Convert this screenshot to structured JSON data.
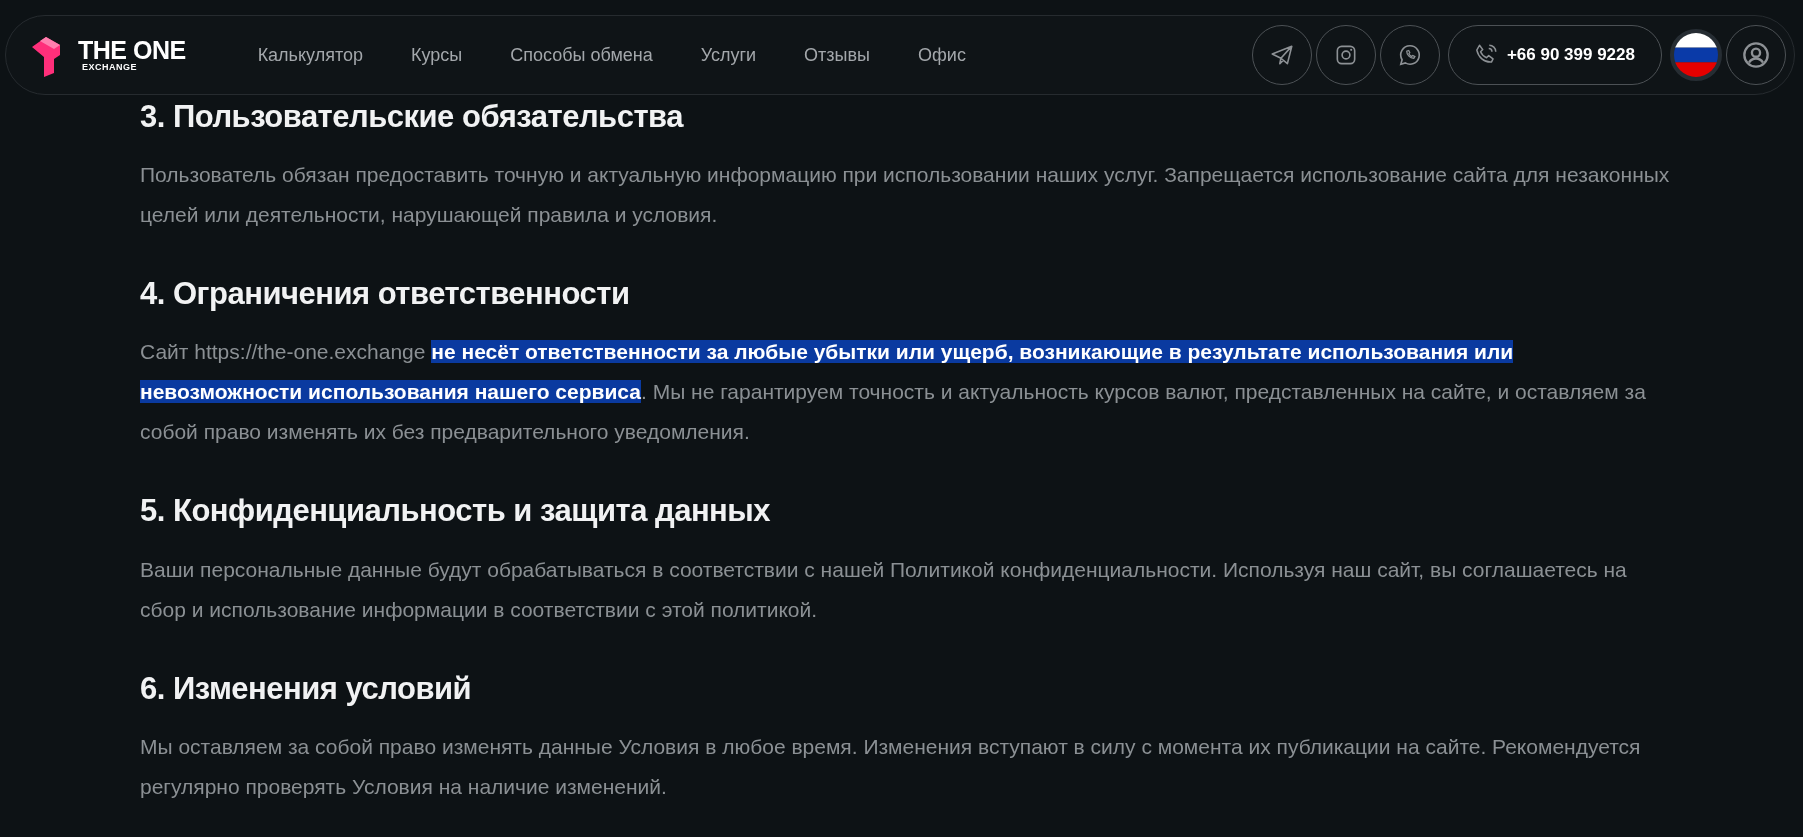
{
  "header": {
    "logo": {
      "title": "THE ONE",
      "subtitle": "EXCHANGE"
    },
    "nav": [
      "Калькулятор",
      "Курсы",
      "Способы обмена",
      "Услуги",
      "Отзывы",
      "Офис"
    ],
    "socials": [
      {
        "kind": "telegram"
      },
      {
        "kind": "instagram"
      },
      {
        "kind": "whatsapp"
      }
    ],
    "phone": "+66 90 399 9228",
    "language": {
      "kind": "ru"
    },
    "account": {
      "kind": "user"
    }
  },
  "sections": [
    {
      "heading": "3. Пользовательские обязательства",
      "segments": [
        {
          "text": "Пользователь обязан предоставить точную и актуальную информацию при использовании наших услуг. Запрещается использование сайта для незаконных целей или деятельности, нарушающей правила и условия.",
          "selected": false
        }
      ]
    },
    {
      "heading": "4. Ограничения ответственности",
      "segments": [
        {
          "text": "Сайт https://the-one.exchange ",
          "selected": false
        },
        {
          "text": "не несёт ответственности за любые убытки или ущерб, возникающие в результате использования или невозможности использования нашего сервиса",
          "selected": true
        },
        {
          "text": ". Мы не гарантируем точность и актуальность курсов валют, представленных на сайте, и оставляем за собой право изменять их без предварительного уведомления.",
          "selected": false
        }
      ]
    },
    {
      "heading": "5. Конфиденциальность и защита данных",
      "segments": [
        {
          "text": "Ваши персональные данные будут обрабатываться в соответствии с нашей Политикой конфиденциальности. Используя наш сайт, вы соглашаетесь на сбор и использование информации в соответствии с этой политикой.",
          "selected": false
        }
      ]
    },
    {
      "heading": "6. Изменения условий",
      "segments": [
        {
          "text": "Мы оставляем за собой право изменять данные Условия в любое время. Изменения вступают в силу с момента их публикации на сайте. Рекомендуется регулярно проверять Условия на наличие изменений.",
          "selected": false
        }
      ]
    }
  ]
}
